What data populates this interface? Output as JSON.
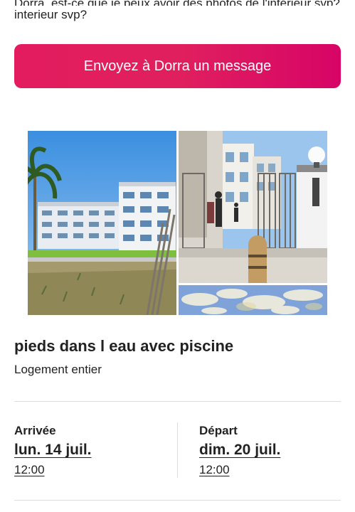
{
  "message": {
    "text_line1_partial": "Dorra, est-ce que je peux avoir des photos de l'intérieur svp?",
    "text_line2": "interieur svp?"
  },
  "actions": {
    "message_button_label": "Envoyez à Dorra un message"
  },
  "listing": {
    "title": "pieds dans l eau avec piscine",
    "type": "Logement entier"
  },
  "stay": {
    "checkin_label": "Arrivée",
    "checkin_date": "lun. 14 juil.",
    "checkin_time": "12:00",
    "checkout_label": "Départ",
    "checkout_date": "dim. 20 juil.",
    "checkout_time": "12:00"
  },
  "colors": {
    "brand": "#e31c5f",
    "text": "#222222",
    "divider": "#dddddd"
  }
}
